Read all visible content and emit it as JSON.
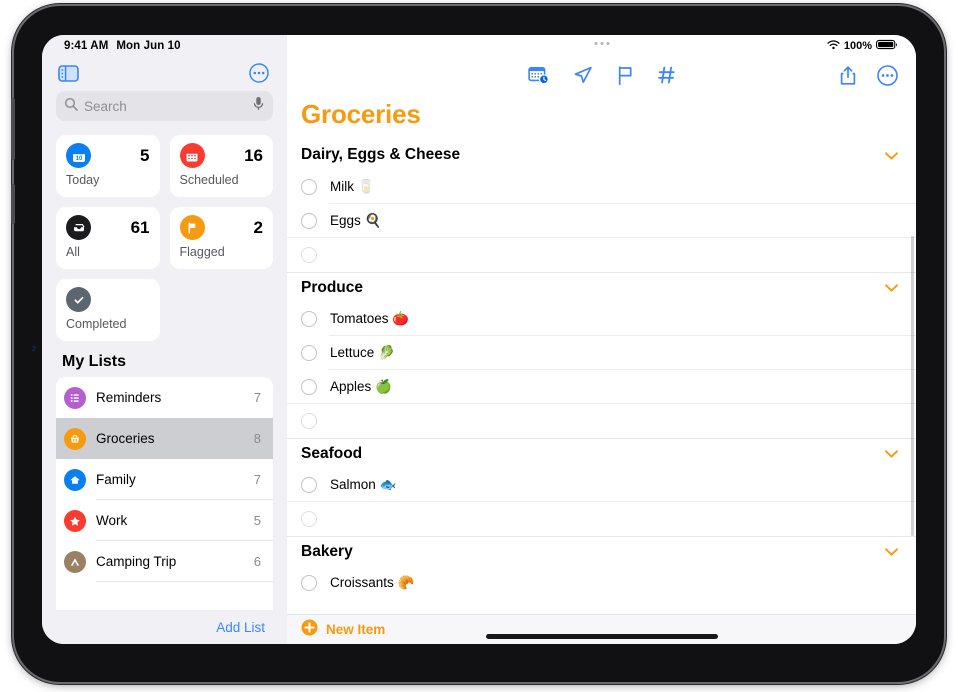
{
  "status_bar": {
    "time": "9:41 AM",
    "date": "Mon Jun 10",
    "wifi_icon": "wifi-icon",
    "battery_percent": "100%",
    "battery_icon": "battery-full-icon"
  },
  "sidebar": {
    "toggle_icon": "sidebar-toggle-icon",
    "more_icon": "ellipsis-circle-icon",
    "search": {
      "placeholder": "Search",
      "search_icon": "search-icon",
      "mic_icon": "microphone-icon"
    },
    "smart_lists": [
      {
        "label": "Today",
        "count": "5",
        "icon": "calendar-day-icon",
        "color": "#0a7ff2",
        "glyph": "10"
      },
      {
        "label": "Scheduled",
        "count": "16",
        "icon": "calendar-icon",
        "color": "#fb3b30",
        "glyph": "▦"
      },
      {
        "label": "All",
        "count": "61",
        "icon": "tray-icon",
        "color": "#1c1c1e",
        "glyph": "▭"
      },
      {
        "label": "Flagged",
        "count": "2",
        "icon": "flag-icon",
        "color": "#f59b0f",
        "glyph": "⚑"
      },
      {
        "label": "Completed",
        "count": "",
        "icon": "checkmark-circle-icon",
        "color": "#5c6670",
        "glyph": "✓"
      }
    ],
    "my_lists_header": "My Lists",
    "lists": [
      {
        "name": "Reminders",
        "count": "7",
        "icon": "list-bullet-icon",
        "color": "#b55fce",
        "glyph": "☰",
        "selected": false
      },
      {
        "name": "Groceries",
        "count": "8",
        "icon": "basket-icon",
        "color": "#f59b0f",
        "glyph": "🧺",
        "selected": true
      },
      {
        "name": "Family",
        "count": "7",
        "icon": "house-icon",
        "color": "#0a7ff2",
        "glyph": "⌂",
        "selected": false
      },
      {
        "name": "Work",
        "count": "5",
        "icon": "star-icon",
        "color": "#fb3b30",
        "glyph": "★",
        "selected": false
      },
      {
        "name": "Camping Trip",
        "count": "6",
        "icon": "tent-icon",
        "color": "#9a8164",
        "glyph": "⛺",
        "selected": false
      }
    ],
    "add_list_label": "Add List"
  },
  "main": {
    "multitask_handle_icon": "multitasking-handle-icon",
    "toolbar": [
      {
        "icon": "calendar-clock-icon",
        "name": "add-date-time-button"
      },
      {
        "icon": "location-arrow-icon",
        "name": "add-location-button"
      },
      {
        "icon": "flag-icon",
        "name": "flag-button"
      },
      {
        "icon": "hashtag-icon",
        "name": "add-tag-button"
      }
    ],
    "toolbar_right": [
      {
        "icon": "share-icon",
        "name": "share-button"
      },
      {
        "icon": "ellipsis-circle-icon",
        "name": "more-options-button"
      }
    ],
    "list_title": "Groceries",
    "title_color": "#f59b0f",
    "sections": [
      {
        "title": "Dairy, Eggs & Cheese",
        "chevron_icon": "chevron-down-icon",
        "items": [
          {
            "text": "Milk 🥛",
            "completed": false
          },
          {
            "text": "Eggs 🍳",
            "completed": false
          },
          {
            "text": "",
            "completed": false,
            "placeholder_row": true
          }
        ]
      },
      {
        "title": "Produce",
        "chevron_icon": "chevron-down-icon",
        "items": [
          {
            "text": "Tomatoes 🍅",
            "completed": false
          },
          {
            "text": "Lettuce 🥬",
            "completed": false
          },
          {
            "text": "Apples 🍏",
            "completed": false
          },
          {
            "text": "",
            "completed": false,
            "placeholder_row": true
          }
        ]
      },
      {
        "title": "Seafood",
        "chevron_icon": "chevron-down-icon",
        "items": [
          {
            "text": "Salmon 🐟",
            "completed": false
          },
          {
            "text": "",
            "completed": false,
            "placeholder_row": true
          }
        ]
      },
      {
        "title": "Bakery",
        "chevron_icon": "chevron-down-icon",
        "items": [
          {
            "text": "Croissants 🥐",
            "completed": false
          }
        ]
      }
    ],
    "new_item": {
      "label": "New Item",
      "icon": "plus-circle-icon"
    }
  },
  "watermark": "2"
}
